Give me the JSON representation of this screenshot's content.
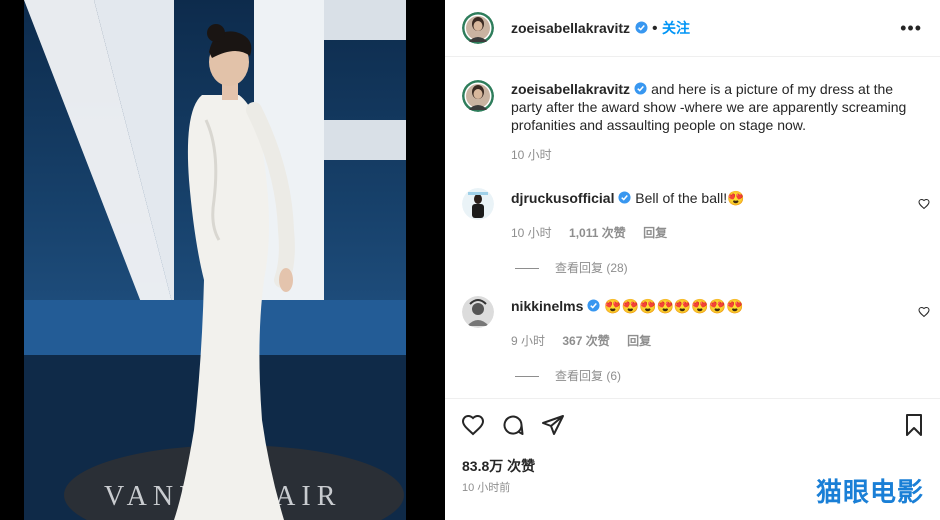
{
  "post": {
    "author": "zoeisabellakravitz",
    "follow_label": "关注",
    "more_icon": "more-options-icon",
    "caption": "and here is a picture of my dress at the party after the award show -where we are apparently screaming profanities and assaulting people on stage now.",
    "caption_time": "10 小时",
    "likes": "83.8万 次赞",
    "posted": "10 小时前"
  },
  "comments": [
    {
      "user": "djruckusofficial",
      "text": "Bell of the ball!😍",
      "time": "10 小时",
      "likes": "1,011 次赞",
      "reply": "回复",
      "view_replies": "查看回复 (28)"
    },
    {
      "user": "nikkinelms",
      "text": "😍😍😍😍😍😍😍😍",
      "time": "9 小时",
      "likes": "367 次赞",
      "reply": "回复",
      "view_replies": "查看回复 (6)"
    }
  ],
  "watermark": "猫眼电影",
  "photo_floor_text": "VANITY FAIR",
  "colors": {
    "follow": "#0095f6",
    "verified": "#3897f0",
    "watermark": "#1a7fd6",
    "heart_emoji": "#e0245e"
  }
}
